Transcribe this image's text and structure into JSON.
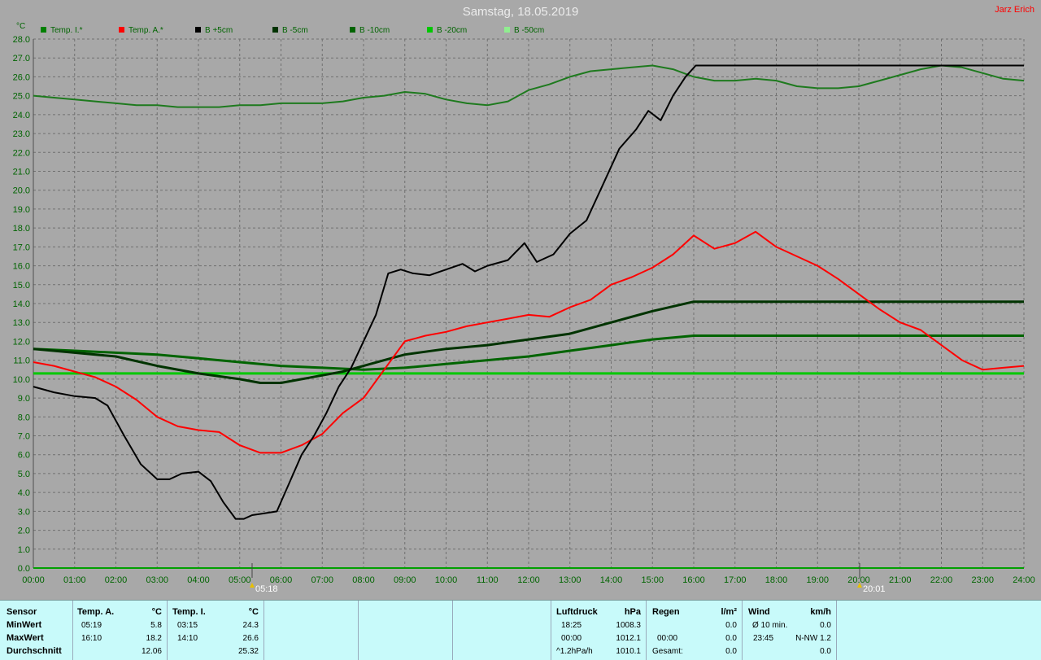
{
  "title": "Samstag, 18.05.2019",
  "author": "Jarz Erich",
  "chart_data": {
    "type": "line",
    "title": "Samstag, 18.05.2019",
    "ylabel": "°C",
    "xlabel": "",
    "ylim": [
      0,
      28
    ],
    "xlim": [
      0,
      24
    ],
    "grid": true,
    "legend_position": "top",
    "x_tick_labels": [
      "00:00",
      "01:00",
      "02:00",
      "03:00",
      "04:00",
      "05:00",
      "06:00",
      "07:00",
      "08:00",
      "09:00",
      "10:00",
      "11:00",
      "12:00",
      "13:00",
      "14:00",
      "15:00",
      "16:00",
      "17:00",
      "18:00",
      "19:00",
      "20:00",
      "21:00",
      "22:00",
      "23:00",
      "24:00"
    ],
    "y_tick_labels": [
      "0.0",
      "1.0",
      "2.0",
      "3.0",
      "4.0",
      "5.0",
      "6.0",
      "7.0",
      "8.0",
      "9.0",
      "10.0",
      "11.0",
      "12.0",
      "13.0",
      "14.0",
      "15.0",
      "16.0",
      "17.0",
      "18.0",
      "19.0",
      "20.0",
      "21.0",
      "22.0",
      "23.0",
      "24.0",
      "25.0",
      "26.0",
      "27.0",
      "28.0"
    ],
    "markers": [
      {
        "label": "05:18",
        "x": 5.3
      },
      {
        "label": "20:01",
        "x": 20.02
      }
    ],
    "legend": [
      {
        "name": "Temp. I.*",
        "color": "#008000"
      },
      {
        "name": "Temp. A.*",
        "color": "#ff0000"
      },
      {
        "name": "B +5cm",
        "color": "#000000"
      },
      {
        "name": "B -5cm",
        "color": "#003300"
      },
      {
        "name": "B -10cm",
        "color": "#006400"
      },
      {
        "name": "B -20cm",
        "color": "#00c800"
      },
      {
        "name": "B -50cm",
        "color": "#90ee90"
      }
    ],
    "series": [
      {
        "name": "Temp. I.*",
        "color": "#1e7a1e",
        "width": 2,
        "x": [
          0,
          0.5,
          1,
          1.5,
          2,
          2.5,
          3,
          3.5,
          4,
          4.5,
          5,
          5.5,
          6,
          6.5,
          7,
          7.5,
          8,
          8.5,
          9,
          9.5,
          10,
          10.5,
          11,
          11.5,
          12,
          12.5,
          13,
          13.5,
          14,
          14.5,
          15,
          15.5,
          16,
          16.5,
          17,
          17.5,
          18,
          18.5,
          19,
          19.5,
          20,
          20.5,
          21,
          21.5,
          22,
          22.5,
          23,
          23.5,
          24
        ],
        "y": [
          25.0,
          24.9,
          24.8,
          24.7,
          24.6,
          24.5,
          24.5,
          24.4,
          24.4,
          24.4,
          24.5,
          24.5,
          24.6,
          24.6,
          24.6,
          24.7,
          24.9,
          25.0,
          25.2,
          25.1,
          24.8,
          24.6,
          24.5,
          24.7,
          25.3,
          25.6,
          26.0,
          26.3,
          26.4,
          26.5,
          26.6,
          26.4,
          26.0,
          25.8,
          25.8,
          25.9,
          25.8,
          25.5,
          25.4,
          25.4,
          25.5,
          25.8,
          26.1,
          26.4,
          26.6,
          26.5,
          26.2,
          25.9,
          25.8
        ]
      },
      {
        "name": "Temp. A.*",
        "color": "#ff0000",
        "width": 2,
        "x": [
          0,
          0.5,
          1,
          1.5,
          2,
          2.5,
          3,
          3.5,
          4,
          4.5,
          5,
          5.5,
          6,
          6.5,
          7,
          7.5,
          8,
          8.5,
          9,
          9.5,
          10,
          10.5,
          11,
          11.5,
          12,
          12.5,
          13,
          13.5,
          14,
          14.5,
          15,
          15.5,
          16,
          16.5,
          17,
          17.5,
          18,
          18.5,
          19,
          19.5,
          20,
          20.5,
          21,
          21.5,
          22,
          22.5,
          23,
          23.5,
          24
        ],
        "y": [
          10.9,
          10.7,
          10.4,
          10.1,
          9.6,
          8.9,
          8.0,
          7.5,
          7.3,
          7.2,
          6.5,
          6.1,
          6.1,
          6.5,
          7.1,
          8.2,
          9.0,
          10.5,
          12.0,
          12.3,
          12.5,
          12.8,
          13.0,
          13.2,
          13.4,
          13.3,
          13.8,
          14.2,
          15.0,
          15.4,
          15.9,
          16.6,
          17.6,
          16.9,
          17.2,
          17.8,
          17.0,
          16.5,
          16.0,
          15.3,
          14.5,
          13.7,
          13.0,
          12.6,
          11.8,
          11.0,
          10.5,
          10.6,
          10.7
        ]
      },
      {
        "name": "B +5cm",
        "color": "#000000",
        "width": 2,
        "x": [
          0,
          0.5,
          1,
          1.5,
          1.8,
          2.2,
          2.6,
          3,
          3.3,
          3.6,
          4,
          4.3,
          4.6,
          4.9,
          5.1,
          5.3,
          5.6,
          5.9,
          6.2,
          6.5,
          6.8,
          7.1,
          7.4,
          7.7,
          8,
          8.3,
          8.6,
          8.9,
          9.2,
          9.6,
          10,
          10.4,
          10.7,
          11,
          11.5,
          11.9,
          12.2,
          12.6,
          13,
          13.4,
          13.8,
          14.2,
          14.6,
          14.9,
          15.2,
          15.5,
          15.8,
          16.05,
          16.5,
          17,
          18,
          20,
          22,
          24
        ],
        "y": [
          9.6,
          9.3,
          9.1,
          9.0,
          8.6,
          7.0,
          5.5,
          4.7,
          4.7,
          5.0,
          5.1,
          4.6,
          3.5,
          2.6,
          2.6,
          2.8,
          2.9,
          3.0,
          4.5,
          6.0,
          7.0,
          8.2,
          9.6,
          10.6,
          12.0,
          13.4,
          15.6,
          15.8,
          15.6,
          15.5,
          15.8,
          16.1,
          15.7,
          16.0,
          16.3,
          17.2,
          16.2,
          16.6,
          17.7,
          18.4,
          20.3,
          22.2,
          23.2,
          24.2,
          23.7,
          25.0,
          26.0,
          26.6,
          26.6,
          26.6,
          26.6,
          26.6,
          26.6,
          26.6
        ]
      },
      {
        "name": "B -5cm",
        "color": "#003300",
        "width": 3,
        "x": [
          0,
          1,
          2,
          3,
          4,
          5,
          5.5,
          6,
          6.5,
          7,
          7.5,
          8,
          8.5,
          9,
          10,
          11,
          12,
          13,
          14,
          15,
          16,
          16.5,
          17,
          18,
          20,
          22,
          24
        ],
        "y": [
          11.6,
          11.4,
          11.2,
          10.7,
          10.3,
          10.0,
          9.8,
          9.8,
          10.0,
          10.2,
          10.4,
          10.7,
          11.0,
          11.3,
          11.6,
          11.8,
          12.1,
          12.4,
          13.0,
          13.6,
          14.1,
          14.1,
          14.1,
          14.1,
          14.1,
          14.1,
          14.1
        ]
      },
      {
        "name": "B -10cm",
        "color": "#006400",
        "width": 3,
        "x": [
          0,
          1,
          2,
          3,
          4,
          5,
          6,
          7,
          8,
          9,
          10,
          11,
          12,
          13,
          14,
          15,
          16,
          17,
          18,
          20,
          22,
          24
        ],
        "y": [
          11.6,
          11.5,
          11.4,
          11.3,
          11.1,
          10.9,
          10.7,
          10.6,
          10.5,
          10.6,
          10.8,
          11.0,
          11.2,
          11.5,
          11.8,
          12.1,
          12.3,
          12.3,
          12.3,
          12.3,
          12.3,
          12.3
        ]
      },
      {
        "name": "B -20cm",
        "color": "#00c800",
        "width": 3,
        "x": [
          0,
          24
        ],
        "y": [
          10.3,
          10.3
        ]
      }
    ]
  },
  "panel": {
    "sensor": {
      "header": "Sensor",
      "rows": [
        "MinWert",
        "MaxWert",
        "Durchschnitt"
      ]
    },
    "temp_a": {
      "header": "Temp. A.",
      "unit": "°C",
      "min_time": "05:19",
      "min": "5.8",
      "max_time": "16:10",
      "max": "18.2",
      "avg": "12.06"
    },
    "temp_i": {
      "header": "Temp. I.",
      "unit": "°C",
      "min_time": "03:15",
      "min": "24.3",
      "max_time": "14:10",
      "max": "26.6",
      "avg": "25.32"
    },
    "pressure": {
      "header": "Luftdruck",
      "unit": "hPa",
      "r1_time": "18:25",
      "r1_val": "1008.3",
      "r2_time": "00:00",
      "r2_val": "1012.1",
      "r3_label": "^1.2hPa/h",
      "r3_val": "1010.1"
    },
    "rain": {
      "header": "Regen",
      "unit": "l/m²",
      "r1_val": "0.0",
      "r2_time": "00:00",
      "r2_val": "0.0",
      "r3_label": "Gesamt:",
      "r3_val": "0.0"
    },
    "wind": {
      "header": "Wind",
      "unit": "km/h",
      "r1_label": "Ø 10 min.",
      "r1_val": "0.0",
      "r2_time": "23:45",
      "r2_val": "N-NW 1.2",
      "r3_val": "0.0"
    }
  }
}
